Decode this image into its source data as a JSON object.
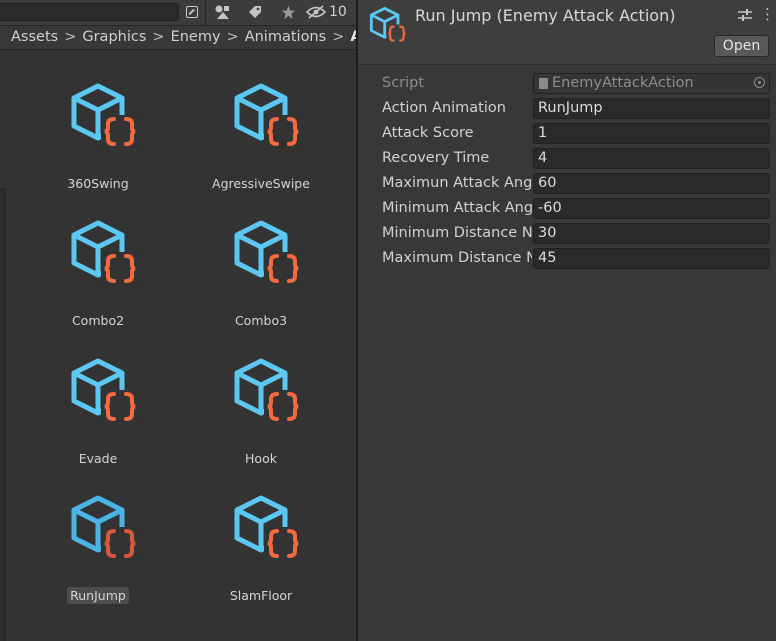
{
  "project": {
    "toolbar": {
      "hidden_count": "10",
      "icons": [
        "search-mode-icon",
        "type-filter-icon",
        "label-filter-icon",
        "star-icon",
        "hidden-eye-icon"
      ]
    },
    "breadcrumb": [
      "Assets",
      "Graphics",
      "Enemy",
      "Animations",
      "At"
    ],
    "assets": [
      {
        "name": "360Swing",
        "selected": false
      },
      {
        "name": "AgressiveSwipe",
        "selected": false
      },
      {
        "name": "Combo2",
        "selected": false
      },
      {
        "name": "Combo3",
        "selected": false
      },
      {
        "name": "Evade",
        "selected": false
      },
      {
        "name": "Hook",
        "selected": false
      },
      {
        "name": "RunJump",
        "selected": true
      },
      {
        "name": "SlamFloor",
        "selected": false
      }
    ],
    "asset_icon": "scriptable-object-icon"
  },
  "inspector": {
    "title": "Run Jump (Enemy Attack Action)",
    "open_label": "Open",
    "script": {
      "label": "Script",
      "value": "EnemyAttackAction"
    },
    "fields": [
      {
        "label": "Action Animation",
        "value": "RunJump"
      },
      {
        "label": "Attack Score",
        "value": "1"
      },
      {
        "label": "Recovery Time",
        "value": "4"
      },
      {
        "label": "Maximun Attack Ang",
        "value": "60"
      },
      {
        "label": "Minimum Attack Ang",
        "value": "-60"
      },
      {
        "label": "Minimum Distance N",
        "value": "30"
      },
      {
        "label": "Maximum Distance N",
        "value": "45"
      }
    ]
  },
  "colors": {
    "cube": "#5cc8f2",
    "braces": "#f26a40",
    "braces_selected": "#d45a3a",
    "panel": "#383838",
    "input": "#2a2a2a"
  }
}
